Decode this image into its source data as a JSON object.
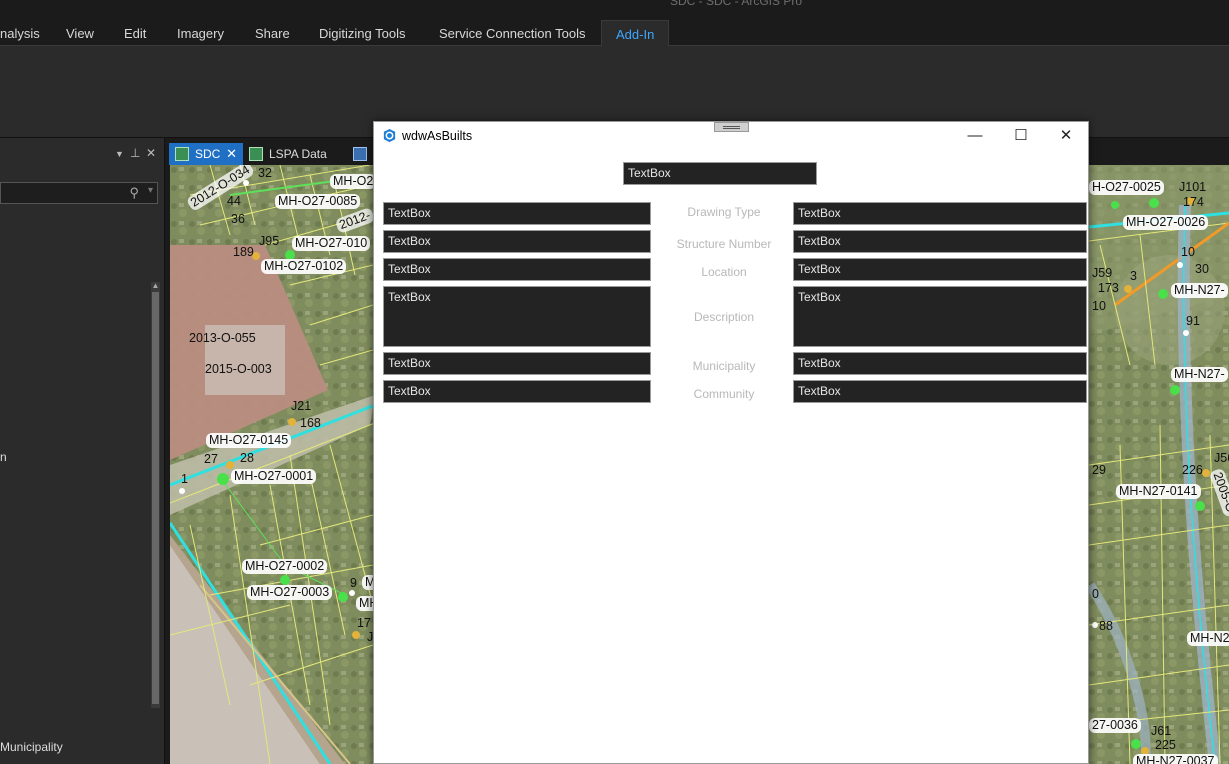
{
  "window": {
    "title": "SDC - SDC - ArcGIS Pro"
  },
  "ribbon_tabs": [
    "nalysis",
    "View",
    "Edit",
    "Imagery",
    "Share",
    "Digitizing Tools",
    "Service Connection Tools",
    "Add-In"
  ],
  "left_pane": {
    "pin": "📌",
    "text_n": "n",
    "text_municipality": "Municipality"
  },
  "map_tabs": [
    {
      "label": "SDC",
      "close": "✕"
    },
    {
      "label": "LSPA Data"
    }
  ],
  "map_labels": {
    "l1": "2012-O-034",
    "l2": "32",
    "l3": "MH-O2",
    "l4": "44",
    "l5": "36",
    "l6": "MH-O27-0085",
    "l7": "2012-",
    "l8": "J95",
    "l9": "189",
    "l10": "MH-O27-010",
    "l11": "MH-O27-0102",
    "l12": "2013-O-055",
    "l13": "2015-O-003",
    "l14": "J21",
    "l15": "168",
    "l16": "MH-O27-0145",
    "l17": "27",
    "l18": "28",
    "l19": "1",
    "l20": "MH-O27-0001",
    "l21": "MH-O27-0002",
    "l22": "9",
    "l23": "M",
    "l24": "MH-O27-0003",
    "l25": "MH",
    "l26": "17",
    "l27": "J",
    "r1": "H-O27-0025",
    "r2": "J101",
    "r3": "174",
    "r4": "MH-O27-0026",
    "r5": "10",
    "r6": "J59",
    "r7": "3",
    "r8": "30",
    "r9": "173",
    "r10": "MH-N27-",
    "r11": "10",
    "r12": "91",
    "r13": "MH-N27-",
    "r14": "29",
    "r15": "226",
    "r16": "J56",
    "r17": "2005-O",
    "r18": "MH-N27-0141",
    "r19": "0",
    "r20": "88",
    "r21": "MH-N2",
    "r22": "27-0036",
    "r23": "J61",
    "r24": "225",
    "r25": "MH-N27-0037"
  },
  "dialog": {
    "title": "wdwAsBuilts",
    "top_textbox": "TextBox",
    "rows": [
      {
        "left": "TextBox",
        "label": "Drawing Type",
        "right": "TextBox"
      },
      {
        "left": "TextBox",
        "label": "Structure Number",
        "right": "TextBox"
      },
      {
        "left": "TextBox",
        "label": "Location",
        "right": "TextBox"
      },
      {
        "left": "TextBox",
        "label": "Description",
        "right": "TextBox"
      },
      {
        "left": "TextBox",
        "label": "Municipality",
        "right": "TextBox"
      },
      {
        "left": "TextBox",
        "label": "Community",
        "right": "TextBox"
      }
    ]
  },
  "colors": {
    "accent": "#3ea7ff",
    "active_tab": "#1f6fc4",
    "textbox_bg": "#232323",
    "road_cyan": "#2fe0e0",
    "parcel_yellow": "#e4e87a"
  }
}
